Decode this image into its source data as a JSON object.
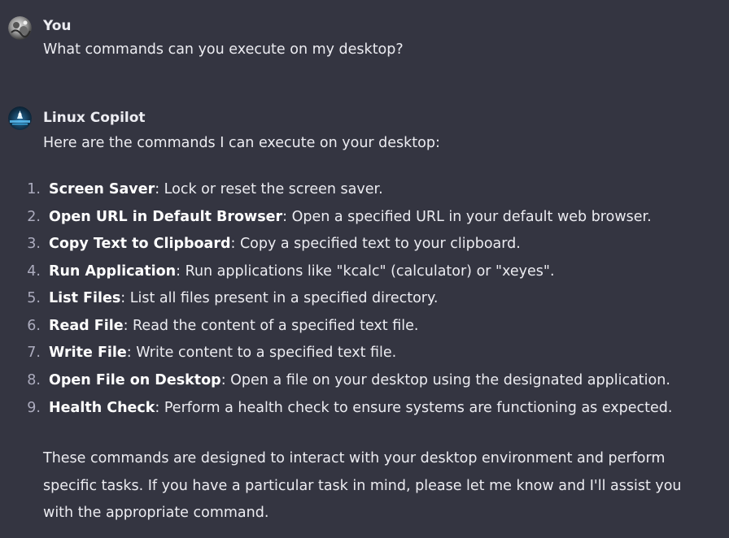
{
  "conversation": {
    "user_message": {
      "author": "You",
      "text": "What commands can you execute on my desktop?",
      "avatar_icon": "user-avatar-icon"
    },
    "assistant_message": {
      "author": "Linux Copilot",
      "intro": "Here are the commands I can execute on your desktop:",
      "avatar_icon": "linux-copilot-avatar-icon",
      "commands": [
        {
          "number": "1.",
          "name": "Screen Saver",
          "description": ": Lock or reset the screen saver."
        },
        {
          "number": "2.",
          "name": "Open URL in Default Browser",
          "description": ": Open a specified URL in your default web browser."
        },
        {
          "number": "3.",
          "name": "Copy Text to Clipboard",
          "description": ": Copy a specified text to your clipboard."
        },
        {
          "number": "4.",
          "name": "Run Application",
          "description": ": Run applications like \"kcalc\" (calculator) or \"xeyes\"."
        },
        {
          "number": "5.",
          "name": "List Files",
          "description": ": List all files present in a specified directory."
        },
        {
          "number": "6.",
          "name": "Read File",
          "description": ": Read the content of a specified text file."
        },
        {
          "number": "7.",
          "name": "Write File",
          "description": ": Write content to a specified text file."
        },
        {
          "number": "8.",
          "name": "Open File on Desktop",
          "description": ": Open a file on your desktop using the designated application."
        },
        {
          "number": "9.",
          "name": "Health Check",
          "description": ": Perform a health check to ensure systems are functioning as expected."
        }
      ],
      "closing": "These commands are designed to interact with your desktop environment and perform specific tasks. If you have a particular task in mind, please let me know and I'll assist you with the appropriate command."
    }
  },
  "colors": {
    "background": "#343541",
    "text": "#ececf1",
    "bold_text": "#ffffff",
    "list_number": "#acacbe"
  }
}
